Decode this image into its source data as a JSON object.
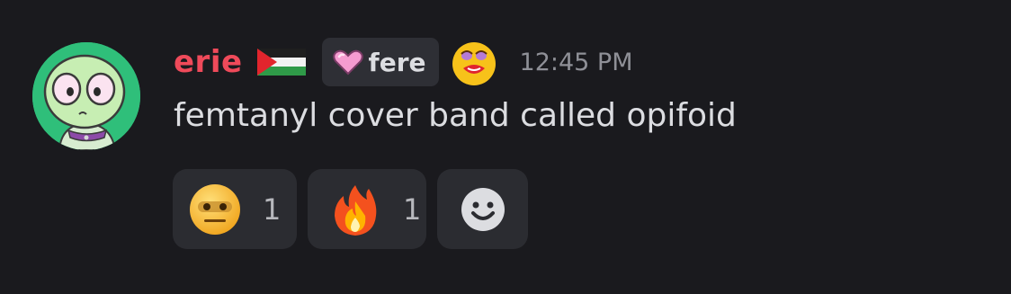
{
  "message": {
    "author": {
      "username": "erie",
      "username_color": "#ef4a5a",
      "flag_icon": "palestine-flag-icon",
      "avatar_icon": "green-cartoon-character-avatar"
    },
    "tag": {
      "icon": "pink-heart-icon",
      "label": "fere"
    },
    "role_emoji_icon": "lips-biting-face-emoji",
    "timestamp": "12:45 PM",
    "content": "femtanyl cover band called opifoid",
    "reactions": [
      {
        "emoji_icon": "dotted-eyes-face-emoji",
        "count": "1"
      },
      {
        "emoji_icon": "fire-emoji",
        "count": "1"
      }
    ],
    "add_reaction_icon": "smiley-add-reaction-icon"
  },
  "colors": {
    "background": "#1a1a1e",
    "reaction_bg": "#2b2c31",
    "text": "#dcdde1",
    "muted": "#8f9097"
  }
}
